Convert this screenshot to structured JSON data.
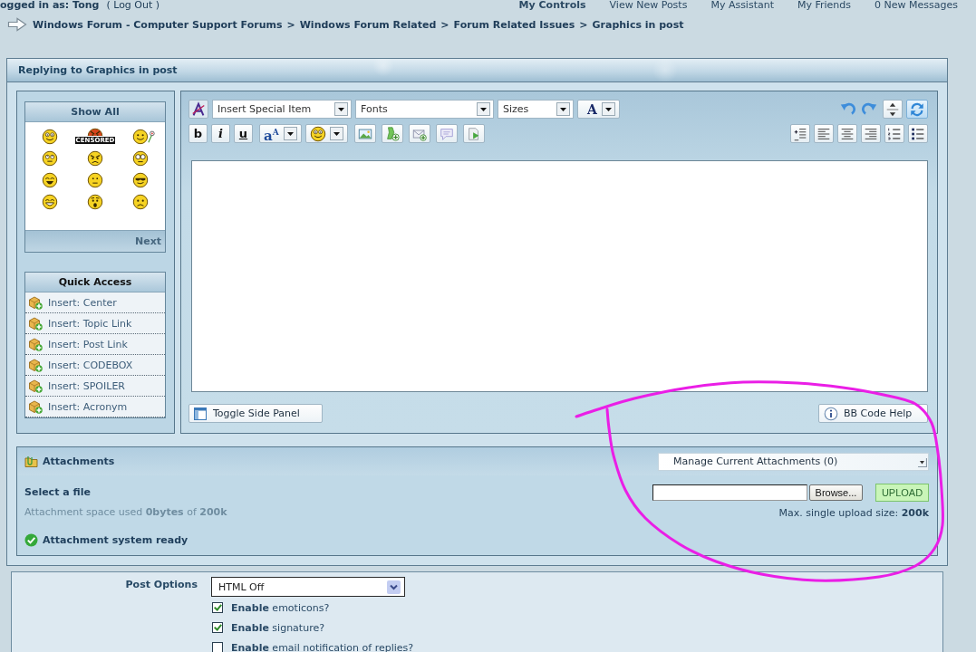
{
  "top_bar": {
    "user": "ogged in as: Tong",
    "logout": "( Log Out )",
    "links": [
      {
        "label": "My Controls",
        "kind": "menu"
      },
      {
        "label": "View New Posts",
        "kind": "link"
      },
      {
        "label": "My Assistant",
        "kind": "link"
      },
      {
        "label": "My Friends",
        "kind": "link"
      },
      {
        "label": "0 New Messages",
        "kind": "link"
      }
    ]
  },
  "breadcrumb": {
    "items": [
      "Windows Forum - Computer Support Forums",
      "Windows Forum Related",
      "Forum Related Issues",
      "Graphics in post"
    ],
    "separators": [
      ">",
      ">",
      ">"
    ]
  },
  "form_title": "Replying to Graphics in post",
  "emoticon_panel": {
    "header": "Show All",
    "censored_tag": "CENSORED",
    "footer": "Next"
  },
  "quick_access": {
    "header": "Quick Access",
    "items": [
      "Insert: Center",
      "Insert: Topic Link",
      "Insert: Post Link",
      "Insert: CODEBOX",
      "Insert: SPOILER",
      "Insert: Acronym"
    ]
  },
  "editor": {
    "dropdowns": [
      "Insert Special Item",
      "Fonts",
      "Sizes"
    ],
    "color_button": "A",
    "bold_button": "b",
    "italic_button": "i",
    "underline_button": "u",
    "font_size_button": "a$^{A}$",
    "toggle_button": "Toggle Side Panel",
    "help_button": "BB Code Help"
  },
  "attachments": {
    "title": "Attachments",
    "manage_dropdown": "Manage Current Attachments (0)",
    "select_label": "Select a file",
    "space_text": "Attachment space used **0bytes** of **200k**",
    "browse_button": "Browse...",
    "upload_button": "UPLOAD",
    "max_text": "Max. single upload size: **200k**",
    "status": "Attachment system ready"
  },
  "post_options": {
    "label": "Post Options",
    "html_mode": "HTML Off",
    "options": [
      {
        "text": "**Enable** emoticons?",
        "checked": true
      },
      {
        "text": "**Enable** signature?",
        "checked": true
      },
      {
        "text": "**Enable** email notification of replies?",
        "checked": false
      }
    ]
  }
}
